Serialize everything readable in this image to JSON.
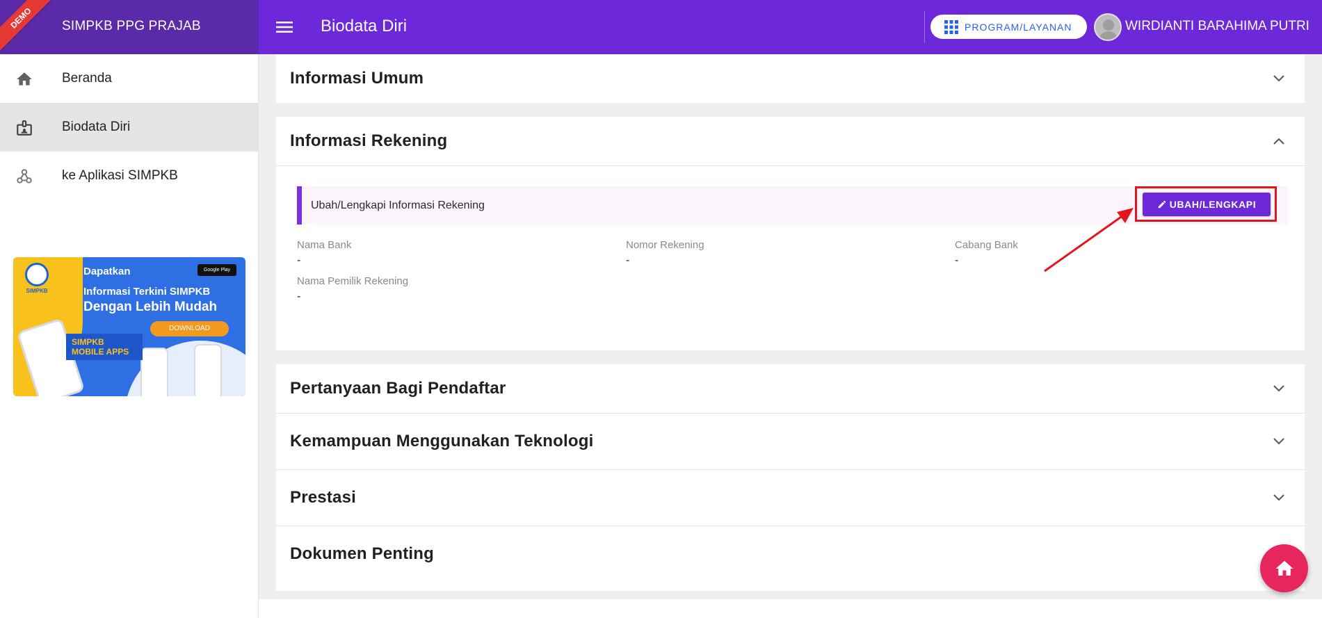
{
  "header": {
    "demo_badge": "DEMO",
    "brand_name": "SIMPKB PPG PRAJAB",
    "page_title": "Biodata Diri",
    "program_button": "PROGRAM/LAYANAN",
    "user_name": "WIRDIANTI BARAHIMA PUTRI"
  },
  "sidebar": {
    "items": [
      {
        "label": "Beranda",
        "icon": "home-icon"
      },
      {
        "label": "Biodata Diri",
        "icon": "badge-icon"
      },
      {
        "label": "ke Aplikasi SIMPKB",
        "icon": "webhook-icon"
      }
    ],
    "banner": {
      "logo_text": "SIMPKB",
      "line1": "Dapatkan",
      "line2": "Informasi Terkini SIMPKB",
      "line3": "Dengan Lebih Mudah",
      "store_badge": "Google Play",
      "download_label": "DOWNLOAD",
      "app_line1": "SIMPKB",
      "app_line2": "MOBILE APPS"
    }
  },
  "panels": {
    "informasi_umum": "Informasi Umum",
    "informasi_rekening": "Informasi Rekening",
    "pertanyaan": "Pertanyaan Bagi Pendaftar",
    "kemampuan": "Kemampuan Menggunakan Teknologi",
    "prestasi": "Prestasi",
    "dokumen": "Dokumen Penting"
  },
  "rekening": {
    "alert_text": "Ubah/Lengkapi Informasi Rekening",
    "edit_button": "UBAH/LENGKAPI",
    "fields": [
      {
        "label": "Nama Bank",
        "value": "-"
      },
      {
        "label": "Nomor Rekening",
        "value": "-"
      },
      {
        "label": "Cabang Bank",
        "value": "-"
      },
      {
        "label": "Nama Pemilik Rekening",
        "value": "-"
      }
    ]
  },
  "colors": {
    "primary": "#6d28d9",
    "brand_bar": "#5b2aa8",
    "highlight": "#e3151a",
    "fab": "#e8265e"
  }
}
